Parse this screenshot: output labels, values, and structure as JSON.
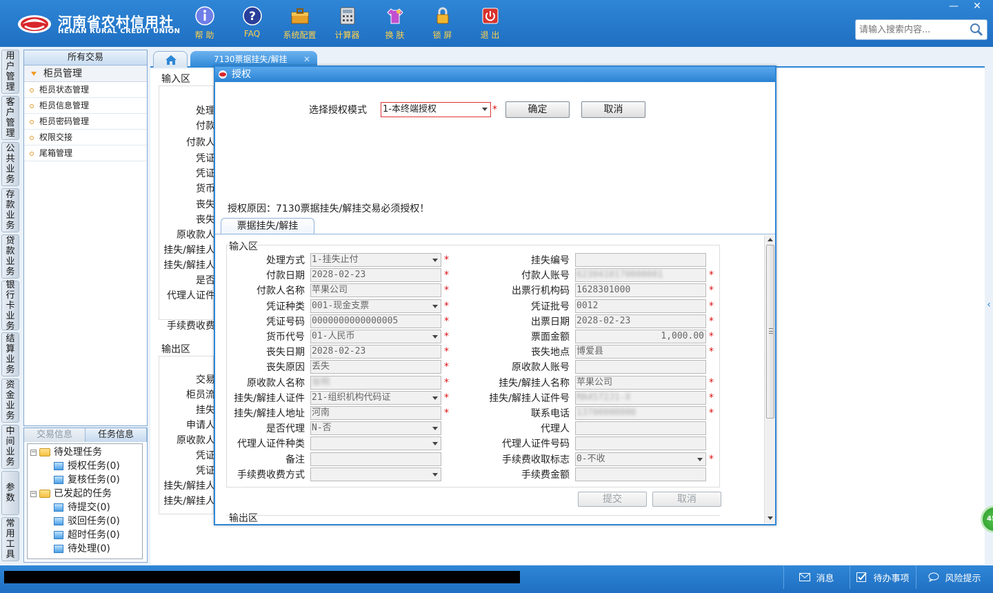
{
  "header": {
    "logo_cn": "河南省农村信用社",
    "logo_en": "HENAN RURAL CREDIT UNION",
    "nav": [
      {
        "label": "帮 助",
        "icon": "info-icon"
      },
      {
        "label": "FAQ",
        "icon": "help-question-icon"
      },
      {
        "label": "系统配置",
        "icon": "config-toolbox-icon"
      },
      {
        "label": "计算器",
        "icon": "calculator-icon"
      },
      {
        "label": "换 肤",
        "icon": "skin-shirt-icon"
      },
      {
        "label": "锁 屏",
        "icon": "lock-icon"
      },
      {
        "label": "退 出",
        "icon": "power-icon"
      }
    ],
    "search_placeholder": "请输入搜索内容...",
    "minimize": "—",
    "close": "✕"
  },
  "vtabs": [
    "用户管理",
    "客户管理",
    "公共业务",
    "存款业务",
    "贷款业务",
    "银行卡业务",
    "结算业务",
    "资金业务",
    "中间业务",
    "参数",
    "常用工具"
  ],
  "menu": {
    "title": "所有交易",
    "group": "柜员管理",
    "items": [
      "柜员状态管理",
      "柜员信息管理",
      "柜员密码管理",
      "权限交接",
      "尾箱管理"
    ]
  },
  "task_panel": {
    "tab_info": "交易信息",
    "tab_task": "任务信息",
    "tree": [
      {
        "label": "待处理任务",
        "toggle": "−",
        "level": 0
      },
      {
        "label": "授权任务(0)",
        "level": 1
      },
      {
        "label": "复核任务(0)",
        "level": 1
      },
      {
        "label": "已发起的任务",
        "toggle": "−",
        "level": 0
      },
      {
        "label": "待提交(0)",
        "level": 1
      },
      {
        "label": "驳回任务(0)",
        "level": 1
      },
      {
        "label": "超时任务(0)",
        "level": 1
      },
      {
        "label": "待处理(0)",
        "level": 1
      }
    ]
  },
  "main": {
    "tab_label": "7130票据挂失/解挂",
    "tab_close": "✕",
    "bg_input_title": "输入区",
    "bg_output_title": "输出区",
    "bg_input_labels": [
      "处理",
      "付款",
      "付款人",
      "凭证",
      "凭证",
      "货币",
      "丧失",
      "丧失",
      "原收款人",
      "挂失/解挂人",
      "挂失/解挂人",
      "是否",
      "代理人证件",
      "手续费收费"
    ],
    "bg_output_labels": [
      "交易",
      "柜员流",
      "挂失",
      "申请人",
      "原收款人",
      "凭证",
      "凭证",
      "挂失/解挂人",
      "挂失/解挂人"
    ]
  },
  "modal": {
    "title": "授权",
    "mode_label": "选择授权模式",
    "mode_value": "1-本终端授权",
    "ok": "确定",
    "cancel": "取消",
    "reason": "授权原因：7130票据挂失/解挂交易必须授权！",
    "inner_tab": "票据挂失/解挂",
    "input_title": "输入区",
    "output_title": "输出区",
    "submit": "提交",
    "form_cancel": "取消",
    "left_fields": [
      {
        "label": "处理方式",
        "value": "1-挂失止付",
        "select": true,
        "req": true
      },
      {
        "label": "付款日期",
        "value": "2028-02-23",
        "req": true
      },
      {
        "label": "付款人名称",
        "value": "苹果公司",
        "req": true
      },
      {
        "label": "凭证种类",
        "value": "001-现金支票",
        "select": true,
        "req": true
      },
      {
        "label": "凭证号码",
        "value": "0000000000000005",
        "req": true
      },
      {
        "label": "货币代号",
        "value": "01-人民币",
        "select": true,
        "req": true
      },
      {
        "label": "丧失日期",
        "value": "2028-02-23",
        "req": true
      },
      {
        "label": "丧失原因",
        "value": "丢失",
        "req": true
      },
      {
        "label": "原收款人名称",
        "value": "张明",
        "blur": true,
        "req": true
      },
      {
        "label": "挂失/解挂人证件",
        "value": "21-组织机构代码证",
        "select": true,
        "req": true
      },
      {
        "label": "挂失/解挂人地址",
        "value": "河南",
        "req": true
      },
      {
        "label": "是否代理",
        "value": "N-否",
        "select": true
      },
      {
        "label": "代理人证件种类",
        "value": "",
        "select": true
      },
      {
        "label": "备注",
        "value": ""
      },
      {
        "label": "手续费收费方式",
        "value": "",
        "select": true
      }
    ],
    "right_fields": [
      {
        "label": "挂失编号",
        "value": ""
      },
      {
        "label": "付款人账号",
        "value": "6230410170000001",
        "blur": true,
        "req": true
      },
      {
        "label": "出票行机构码",
        "value": "1628301000",
        "req": true
      },
      {
        "label": "凭证批号",
        "value": "0012",
        "req": true
      },
      {
        "label": "出票日期",
        "value": "2028-02-23",
        "req": true
      },
      {
        "label": "票面金额",
        "value": "1,000.00",
        "right": true,
        "req": true
      },
      {
        "label": "丧失地点",
        "value": "博爱县",
        "req": true
      },
      {
        "label": "原收款人账号",
        "value": ""
      },
      {
        "label": "挂失/解挂人名称",
        "value": "苹果公司",
        "req": true
      },
      {
        "label": "挂失/解挂人证件号",
        "value": "MA4572J1-X",
        "blur": true,
        "req": true
      },
      {
        "label": "联系电话",
        "value": "13700000000",
        "blur": true,
        "req": true
      },
      {
        "label": "代理人",
        "value": ""
      },
      {
        "label": "代理人证件号码",
        "value": ""
      },
      {
        "label": "手续费收取标志",
        "value": "0-不收",
        "select": true,
        "req": true
      },
      {
        "label": "手续费金额",
        "value": ""
      }
    ]
  },
  "status": {
    "message": "消息",
    "todo": "待办事项",
    "risk": "风险提示",
    "bubble": "45"
  },
  "side_arrow": "‹"
}
